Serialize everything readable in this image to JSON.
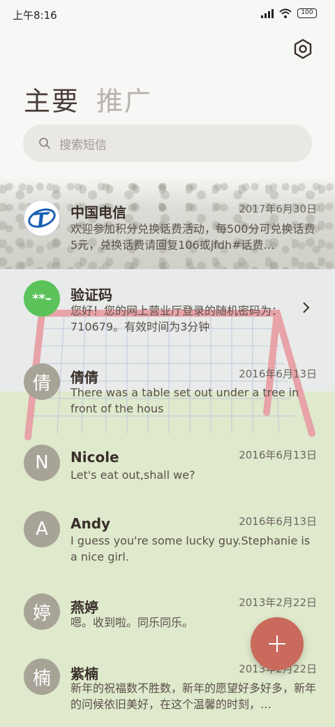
{
  "status_bar": {
    "time": "上午8:16",
    "battery": "100"
  },
  "header": {
    "tab_primary": "主要",
    "tab_secondary": "推广"
  },
  "search": {
    "placeholder": "搜索短信"
  },
  "messages": [
    {
      "name": "中国电信",
      "date": "2017年6月30日",
      "preview": "欢迎参加积分兑换话费活动，每500分可兑换话费5元，兑换话费请回复106或jfdh#话费…",
      "avatar": "",
      "avatar_color": "#ffffff"
    },
    {
      "name": "验证码",
      "date": "",
      "preview": "您好！您的网上营业厅登录的随机密码为：710679。有效时间为3分钟",
      "avatar": "**–",
      "avatar_color": "#5cc35a"
    },
    {
      "name": "倩倩",
      "date": "2016年6月13日",
      "preview": "There was a table set out under a tree in front of the hous",
      "avatar": "倩",
      "avatar_color": "#a8a397"
    },
    {
      "name": "Nicole",
      "date": "2016年6月13日",
      "preview": "Let's eat out,shall we?",
      "avatar": "N",
      "avatar_color": "#a8a397"
    },
    {
      "name": "Andy",
      "date": "2016年6月13日",
      "preview": "I guess you're some lucky guy.Stephanie is a nice girl.",
      "avatar": "A",
      "avatar_color": "#a8a397"
    },
    {
      "name": "燕婷",
      "date": "2013年2月22日",
      "preview": "嗯。收到啦。同乐同乐。",
      "avatar": "婷",
      "avatar_color": "#a8a397"
    },
    {
      "name": "紫楠",
      "date": "2013年2月22日",
      "preview": "新年的祝福数不胜数，新年的愿望好多好多，新年的问候依旧美好，在这个温馨的时刻，…",
      "avatar": "楠",
      "avatar_color": "#a8a397"
    }
  ],
  "icons": {
    "settings": "hexagon-gear-icon",
    "search": "search-icon",
    "compose": "plus-icon",
    "expand": "chevron-right-icon"
  },
  "colors": {
    "fab": "#c96a5c",
    "verify_avatar": "#5cc35a",
    "telecom_blue": "#1a5fb4"
  }
}
